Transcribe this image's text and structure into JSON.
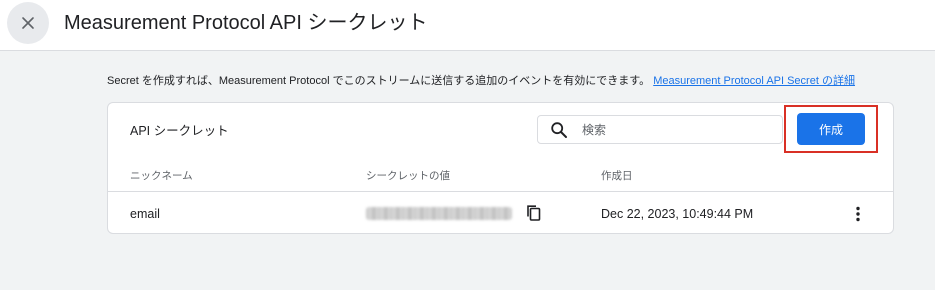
{
  "header": {
    "title": "Measurement Protocol API シークレット"
  },
  "info": {
    "text": "Secret を作成すれば、Measurement Protocol でこのストリームに送信する追加のイベントを有効にできます。",
    "link_label": "Measurement Protocol API Secret の詳細"
  },
  "card": {
    "title": "API シークレット",
    "search": {
      "placeholder": "検索",
      "value": ""
    },
    "create_label": "作成",
    "columns": [
      "ニックネーム",
      "シークレットの値",
      "作成日"
    ],
    "rows": [
      {
        "nickname": "email",
        "created": "Dec 22, 2023, 10:49:44 PM"
      }
    ]
  },
  "colors": {
    "accent": "#1a73e8",
    "highlight": "#d93025",
    "background": "#f1f3f4"
  },
  "icons": [
    "close-icon",
    "search-icon",
    "copy-icon",
    "more-vert-icon"
  ]
}
